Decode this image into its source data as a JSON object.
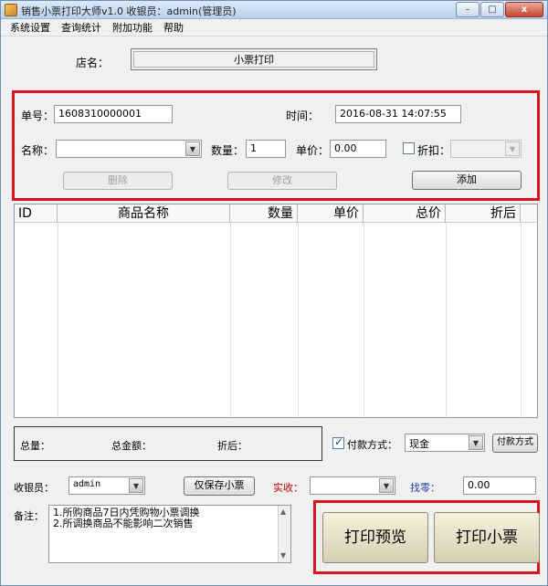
{
  "window": {
    "title": "销售小票打印大师v1.0      收银员：admin(管理员)",
    "minimize": "–",
    "maximize": "□",
    "close": "x"
  },
  "menu": [
    "系统设置",
    "查询统计",
    "附加功能",
    "帮助"
  ],
  "store": {
    "label": "店名：",
    "value": "小票打印"
  },
  "form": {
    "order_label": "单号：",
    "order_value": "1608310000001",
    "time_label": "时间：",
    "time_value": "2016-08-31  14:07:55",
    "name_label": "名称：",
    "name_value": "",
    "qty_label": "数量：",
    "qty_value": "1",
    "price_label": "单价：",
    "price_value": "0.00",
    "discount_label": "折扣：",
    "delete_button": "删除",
    "edit_button": "修改",
    "add_button": "添加"
  },
  "table": {
    "columns": [
      "ID",
      "商品名称",
      "数量",
      "单价",
      "总价",
      "折后"
    ],
    "rows": []
  },
  "totals": {
    "total_qty_label": "总量：",
    "total_amount_label": "总金额：",
    "after_discount_label": "折后："
  },
  "payment": {
    "checked": true,
    "label": "付款方式：",
    "method": "现金",
    "button": "付款方式"
  },
  "cashier": {
    "label": "收银员：",
    "value": "admin",
    "save_only_button": "仅保存小票",
    "received_label": "实收：",
    "received_value": "",
    "change_label": "找零：",
    "change_value": "0.00"
  },
  "notes": {
    "label": "备注：",
    "lines": [
      "1.所购商品7日内凭购物小票调换",
      "2.所调换商品不能影响二次销售"
    ]
  },
  "actions": {
    "preview": "打印预览",
    "print": "打印小票"
  },
  "colors": {
    "highlight": "#d7151b",
    "received_label": "#c00000",
    "change_label": "#1f3fb0"
  }
}
